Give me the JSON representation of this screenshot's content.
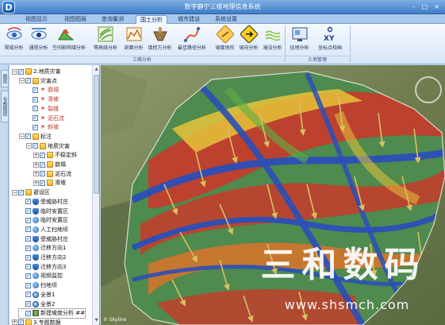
{
  "app": {
    "title": "数字静宁三维地理信息系统",
    "logo_letter": "D"
  },
  "window_controls": {
    "minimize": "–",
    "maximize": "□",
    "close": "×"
  },
  "tabs": [
    {
      "label": "视图显示",
      "active": false
    },
    {
      "label": "视图图层",
      "active": false
    },
    {
      "label": "查询量测",
      "active": false
    },
    {
      "label": "国土分析",
      "active": true
    },
    {
      "label": "城市建设",
      "active": false
    },
    {
      "label": "系统设置",
      "active": false
    }
  ],
  "ribbon": {
    "group_sanwei": {
      "label": "三维分析",
      "buttons": [
        {
          "label": "视域分析",
          "icon": "viewshed-icon"
        },
        {
          "label": "通视分析",
          "icon": "line-of-sight-icon"
        },
        {
          "label": "空间影响域分析",
          "icon": "influence-area-icon"
        },
        {
          "label": "等高线分析",
          "icon": "contour-icon"
        },
        {
          "label": "剖面分析",
          "icon": "profile-icon"
        },
        {
          "label": "填挖方分析",
          "icon": "cut-fill-icon"
        },
        {
          "label": "最佳路径分析",
          "icon": "best-path-icon"
        },
        {
          "label": "坡度地形",
          "icon": "slope-icon"
        },
        {
          "label": "坡向分析",
          "icon": "aspect-icon"
        },
        {
          "label": "淹没分析",
          "icon": "flood-icon"
        }
      ]
    },
    "group_tudi": {
      "label": "土地管理",
      "buttons": [
        {
          "label": "征地分析",
          "icon": "land-acquisition-icon"
        },
        {
          "label": "坐标点校画",
          "icon": "coordinate-xy-icon"
        }
      ]
    }
  },
  "side_tabs": [
    "图层",
    "专题图层"
  ],
  "tree": [
    {
      "label": "2.地质灾害",
      "level": 0,
      "expander": "−",
      "icon": "folder"
    },
    {
      "label": "灾害点",
      "level": 1,
      "expander": "−",
      "icon": "folder"
    },
    {
      "label": "崩塌",
      "level": 2,
      "icon": "spark",
      "color": "#c0392b"
    },
    {
      "label": "滑坡",
      "level": 2,
      "icon": "spark",
      "color": "#c0392b"
    },
    {
      "label": "裂缝",
      "level": 2,
      "icon": "spark",
      "color": "#c0392b"
    },
    {
      "label": "泥石流",
      "level": 2,
      "icon": "spark",
      "color": "#c0392b"
    },
    {
      "label": "斜坡",
      "level": 2,
      "icon": "spark",
      "color": "#c0392b"
    },
    {
      "label": "标注",
      "level": 1,
      "expander": "−",
      "icon": "folder"
    },
    {
      "label": "地质灾害",
      "level": 2,
      "expander": "−",
      "icon": "folder"
    },
    {
      "label": "不稳定斜",
      "level": 3,
      "expander": "+",
      "icon": "folder"
    },
    {
      "label": "崩塌",
      "level": 3,
      "expander": "+",
      "icon": "folder"
    },
    {
      "label": "泥石流",
      "level": 3,
      "expander": "+",
      "icon": "folder"
    },
    {
      "label": "滑坡",
      "level": 3,
      "expander": "+",
      "icon": "folder"
    },
    {
      "label": "避设区",
      "level": 0,
      "expander": "−",
      "icon": "folder"
    },
    {
      "label": "受威胁村庄",
      "level": 1,
      "icon": "shield"
    },
    {
      "label": "临时安置区",
      "level": 1,
      "icon": "shield"
    },
    {
      "label": "临时安置区",
      "level": 1,
      "icon": "pin"
    },
    {
      "label": "人工扫地坝",
      "level": 1,
      "icon": "pin"
    },
    {
      "label": "受威胁村庄",
      "level": 1,
      "icon": "shield"
    },
    {
      "label": "迁移方向1",
      "level": 1,
      "icon": "pin"
    },
    {
      "label": "迁移方向2",
      "level": 1,
      "icon": "shield"
    },
    {
      "label": "迁移方向3",
      "level": 1,
      "icon": "shield"
    },
    {
      "label": "视频监控",
      "level": 1,
      "icon": "pin"
    },
    {
      "label": "扫地坝",
      "level": 1,
      "icon": "pin"
    },
    {
      "label": "全景1",
      "level": 1,
      "icon": "globe"
    },
    {
      "label": "全景2",
      "level": 1,
      "icon": "globe"
    },
    {
      "label": "新建坡度分析 ##",
      "level": 1,
      "icon": "grid",
      "selected": true
    },
    {
      "label": "3.专题数据",
      "level": 0,
      "expander": "+",
      "icon": "folder"
    }
  ],
  "map": {
    "attribution": "© Skyline",
    "watermark": "三和数码",
    "watermark_url": "www.shsmch.com"
  },
  "colors": {
    "title_bar": "#3e7cc4",
    "ribbon_bg": "#d7e6f8",
    "slope_high": "#c8392b",
    "slope_mid": "#e6c33a",
    "slope_low": "#2a4fb8",
    "arrow": "#c9b14a"
  }
}
